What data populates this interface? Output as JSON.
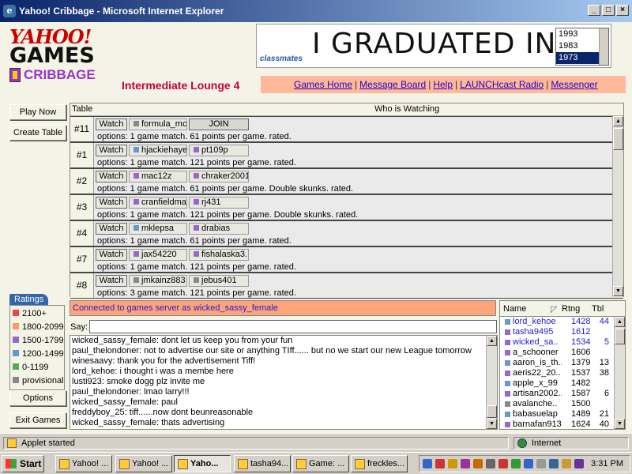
{
  "window": {
    "title": "Yahoo! Cribbage - Microsoft Internet Explorer"
  },
  "logo": {
    "line1": "YAHOO!",
    "line2": "GAMES",
    "line3": "CRIBBAGE"
  },
  "lounge_title": "Intermediate Lounge 4",
  "ad": {
    "brand": "classmates",
    "headline": "I GRADUATED IN:",
    "years": [
      "1993",
      "1983",
      "1973"
    ],
    "selected_year": "1973"
  },
  "nav": {
    "links": [
      "Games Home",
      "Message Board",
      "Help",
      "LAUNCHcast Radio",
      "Messenger"
    ]
  },
  "sidebar": {
    "play_now": "Play Now",
    "create_table": "Create Table",
    "options": "Options",
    "exit_games": "Exit Games"
  },
  "tables": {
    "header_table": "Table",
    "header_watching": "Who is Watching",
    "watch_label": "Watch",
    "join_label": "JOIN",
    "rows": [
      {
        "num": "#11",
        "p1": "formula_mc",
        "p1_color": "#888888",
        "p2": "JOIN",
        "p2_color": "",
        "options": "options: 1 game match. 61 points per game. rated."
      },
      {
        "num": "#1",
        "p1": "hjackiehayes",
        "p1_color": "#6699cc",
        "p2": "pt109p",
        "p2_color": "#9966cc",
        "options": "options: 1 game match. 121 points per game. rated."
      },
      {
        "num": "#2",
        "p1": "mac12z",
        "p1_color": "#9966cc",
        "p2": "chraker2001",
        "p2_color": "#9966cc",
        "options": "options: 1 game match. 61 points per game. Double skunks. rated."
      },
      {
        "num": "#3",
        "p1": "cranfieldma..",
        "p1_color": "#9966cc",
        "p2": "rj431",
        "p2_color": "#9966cc",
        "options": "options: 1 game match. 121 points per game. Double skunks. rated."
      },
      {
        "num": "#4",
        "p1": "mklepsa",
        "p1_color": "#6699cc",
        "p2": "drabias",
        "p2_color": "#9966cc",
        "options": "options: 1 game match. 61 points per game. rated."
      },
      {
        "num": "#7",
        "p1": "jax54220",
        "p1_color": "#9966cc",
        "p2": "fishalaska3..",
        "p2_color": "#9966cc",
        "options": "options: 1 game match. 121 points per game. rated."
      },
      {
        "num": "#8",
        "p1": "jmkainz883",
        "p1_color": "#888888",
        "p2": "jebus401",
        "p2_color": "#888888",
        "options": "options: 3 game match. 121 points per game. rated."
      }
    ]
  },
  "ratings": {
    "title": "Ratings",
    "items": [
      {
        "label": "2100+",
        "color": "#ee4444"
      },
      {
        "label": "1800-2099",
        "color": "#ff9966"
      },
      {
        "label": "1500-1799",
        "color": "#9966cc"
      },
      {
        "label": "1200-1499",
        "color": "#6699cc"
      },
      {
        "label": "0-1199",
        "color": "#55aa55"
      },
      {
        "label": "provisional",
        "color": "#888888"
      }
    ]
  },
  "status": {
    "connected": "Connected to games server as wicked_sassy_female"
  },
  "chat": {
    "say_label": "Say:",
    "say_value": "",
    "lines": [
      "wicked_sassy_female: dont let us keep you from your fun",
      "paul_thelondoner: not to advertise our site or anything TIff...... but no we start our new League tomorrow",
      "winesaavy: thank you for the advertisement Tiff!",
      "lord_kehoe: i thought i was a membe here",
      "lusti923: smoke dogg plz invite me",
      "paul_thelondoner: lmao larry!!!",
      "wicked_sassy_female: paul",
      "freddyboy_25: tiff......now dont beunreasonable",
      "wicked_sassy_female:  thats advertising"
    ]
  },
  "players": {
    "header_name": "Name",
    "header_rating": "Rtng",
    "header_table": "Tbl",
    "rows": [
      {
        "name": "lord_kehoe",
        "rating": "1428",
        "table": "44",
        "color": "#6699cc",
        "blue": true
      },
      {
        "name": "tasha9495",
        "rating": "1612",
        "table": "",
        "color": "#9966cc",
        "blue": true
      },
      {
        "name": "wicked_sa..",
        "rating": "1534",
        "table": "5",
        "color": "#9966cc",
        "blue": true
      },
      {
        "name": "a_schooner",
        "rating": "1606",
        "table": "",
        "color": "#9966cc",
        "blue": false
      },
      {
        "name": "aaron_is_th..",
        "rating": "1379",
        "table": "13",
        "color": "#6699cc",
        "blue": false
      },
      {
        "name": "aeris22_20..",
        "rating": "1537",
        "table": "38",
        "color": "#9966cc",
        "blue": false
      },
      {
        "name": "apple_x_99",
        "rating": "1482",
        "table": "",
        "color": "#6699cc",
        "blue": false
      },
      {
        "name": "artisan2002..",
        "rating": "1587",
        "table": "6",
        "color": "#9966cc",
        "blue": false
      },
      {
        "name": "avalanche..",
        "rating": "1500",
        "table": "",
        "color": "#888888",
        "blue": false
      },
      {
        "name": "babasuelap",
        "rating": "1489",
        "table": "21",
        "color": "#6699cc",
        "blue": false
      },
      {
        "name": "barnafan913",
        "rating": "1624",
        "table": "40",
        "color": "#9966cc",
        "blue": false
      }
    ]
  },
  "ie_status": {
    "left": "Applet started",
    "zone": "Internet"
  },
  "taskbar": {
    "start": "Start",
    "tasks": [
      "Yahoo! ...",
      "Yahoo! ...",
      "Yaho...",
      "tasha94...",
      "Game: ...",
      "freckles..."
    ],
    "active_task": 2,
    "clock": "3:31 PM"
  }
}
